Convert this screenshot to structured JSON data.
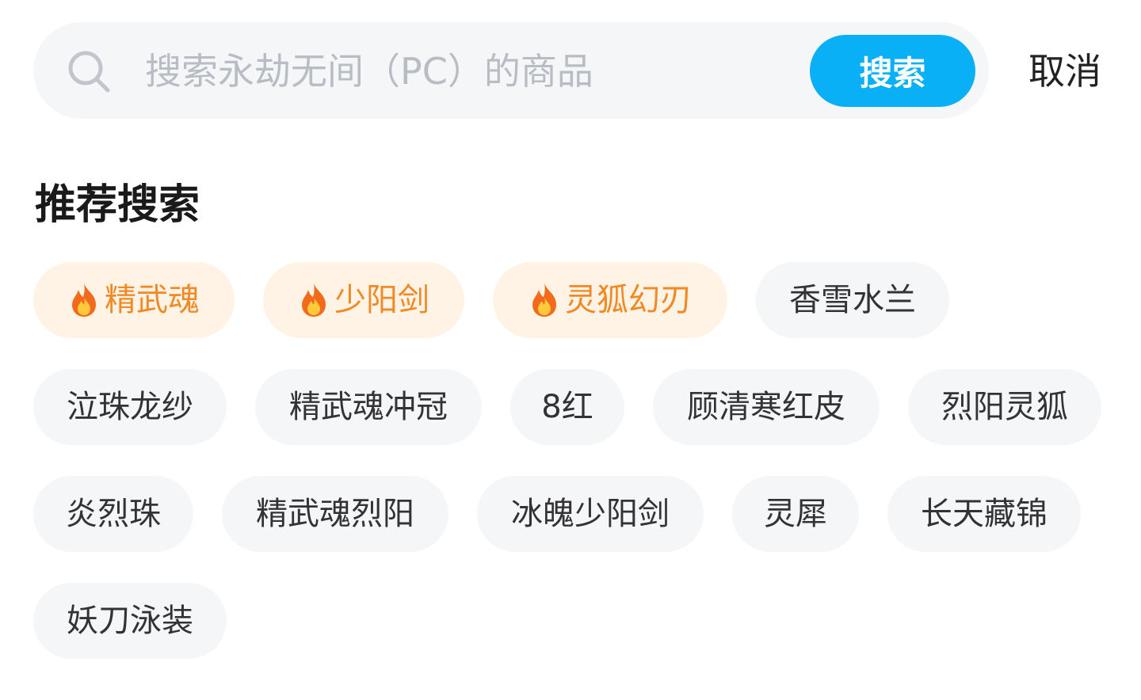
{
  "search": {
    "placeholder": "搜索永劫无间（PC）的商品",
    "button_label": "搜索",
    "cancel_label": "取消"
  },
  "recommend": {
    "title": "推荐搜索",
    "tags": [
      {
        "label": "精武魂",
        "hot": true
      },
      {
        "label": "少阳剑",
        "hot": true
      },
      {
        "label": "灵狐幻刃",
        "hot": true
      },
      {
        "label": "香雪水兰",
        "hot": false
      },
      {
        "label": "泣珠龙纱",
        "hot": false
      },
      {
        "label": "精武魂冲冠",
        "hot": false
      },
      {
        "label": "8红",
        "hot": false
      },
      {
        "label": "顾清寒红皮",
        "hot": false
      },
      {
        "label": "烈阳灵狐",
        "hot": false
      },
      {
        "label": "炎烈珠",
        "hot": false
      },
      {
        "label": "精武魂烈阳",
        "hot": false
      },
      {
        "label": "冰魄少阳剑",
        "hot": false
      },
      {
        "label": "灵犀",
        "hot": false
      },
      {
        "label": "长天藏锦",
        "hot": false
      },
      {
        "label": "妖刀泳装",
        "hot": false
      }
    ]
  },
  "colors": {
    "accent": "#0ab0f5",
    "hot_text": "#f08a24",
    "hot_bg": "#fff3e6",
    "tag_bg": "#f5f6f8"
  }
}
